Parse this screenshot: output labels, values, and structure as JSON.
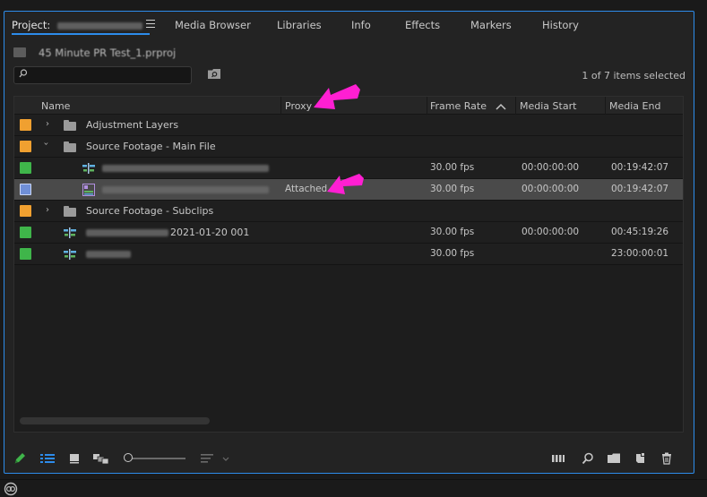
{
  "tabs": [
    {
      "label": "Project:"
    },
    {
      "label": "Media Browser"
    },
    {
      "label": "Libraries"
    },
    {
      "label": "Info"
    },
    {
      "label": "Effects"
    },
    {
      "label": "Markers"
    },
    {
      "label": "History"
    }
  ],
  "project": {
    "file_name": "45 Minute PR Test_1.prproj"
  },
  "search": {
    "placeholder": ""
  },
  "status": {
    "selection": "1 of 7 items selected"
  },
  "columns": {
    "name": "Name",
    "proxy": "Proxy",
    "frame_rate": "Frame Rate",
    "media_start": "Media Start",
    "media_end": "Media End"
  },
  "rows": [
    {
      "name": "Adjustment Layers",
      "kind": "folder",
      "color": "#f0a030",
      "proxy": "",
      "frame_rate": "",
      "media_start": "",
      "media_end": ""
    },
    {
      "name": "Source Footage - Main File",
      "kind": "folder",
      "color": "#f0a030",
      "proxy": "",
      "frame_rate": "",
      "media_start": "",
      "media_end": ""
    },
    {
      "name": "",
      "kind": "sequence",
      "color": "#3fb54a",
      "proxy": "",
      "frame_rate": "30.00 fps",
      "media_start": "00:00:00:00",
      "media_end": "00:19:42:07"
    },
    {
      "name": "",
      "kind": "clip",
      "color": "#6f8fd8",
      "proxy": "Attached",
      "frame_rate": "30.00 fps",
      "media_start": "00:00:00:00",
      "media_end": "00:19:42:07"
    },
    {
      "name": "Source Footage - Subclips",
      "kind": "folder",
      "color": "#f0a030",
      "proxy": "",
      "frame_rate": "",
      "media_start": "",
      "media_end": ""
    },
    {
      "name": "2021-01-20 001",
      "kind": "sequence",
      "color": "#3fb54a",
      "proxy": "",
      "frame_rate": "30.00 fps",
      "media_start": "00:00:00:00",
      "media_end": "00:45:19:26"
    },
    {
      "name": "",
      "kind": "sequence",
      "color": "#3fb54a",
      "proxy": "",
      "frame_rate": "30.00 fps",
      "media_start": "",
      "media_end": "23:00:00:01"
    }
  ],
  "colors": {
    "accent": "#2d8ceb",
    "arrow": "#ff1fd2",
    "folder_label": "#f0a030",
    "sequence_label": "#3fb54a",
    "clip_label": "#6f8fd8"
  }
}
